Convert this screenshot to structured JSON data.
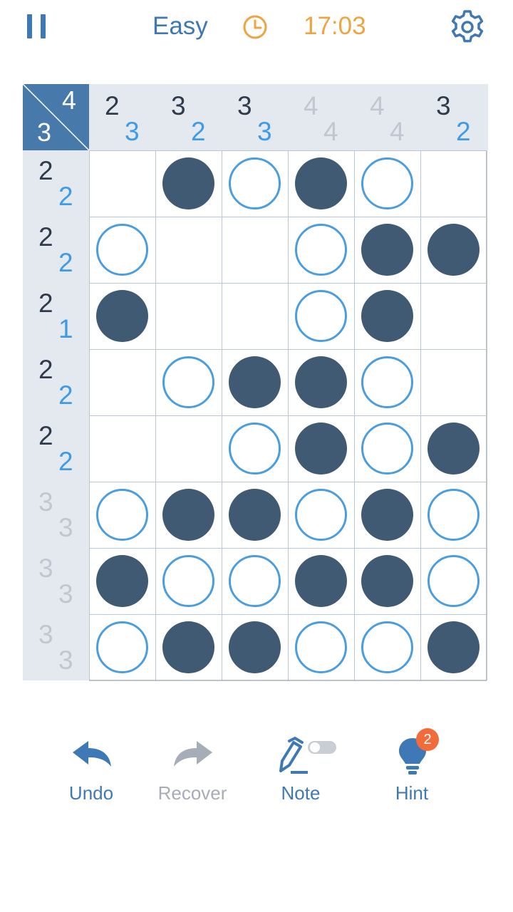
{
  "header": {
    "difficulty": "Easy",
    "timer": "17:03",
    "accent_color": "#3f79b5",
    "timer_color": "#f0a441",
    "icons": [
      "pause-icon",
      "clock-icon",
      "gear-icon"
    ]
  },
  "corner": {
    "top": "4",
    "bottom": "3"
  },
  "columns": [
    {
      "top": "2",
      "bottom": "3",
      "state": "active"
    },
    {
      "top": "3",
      "bottom": "2",
      "state": "active"
    },
    {
      "top": "3",
      "bottom": "3",
      "state": "active"
    },
    {
      "top": "4",
      "bottom": "4",
      "state": "done"
    },
    {
      "top": "4",
      "bottom": "4",
      "state": "done"
    },
    {
      "top": "3",
      "bottom": "2",
      "state": "active"
    }
  ],
  "rows": [
    {
      "top": "2",
      "bottom": "2",
      "state": "active",
      "cells": [
        "",
        "B",
        "W",
        "B",
        "W",
        ""
      ]
    },
    {
      "top": "2",
      "bottom": "2",
      "state": "active",
      "cells": [
        "W",
        "",
        "",
        "W",
        "B",
        "B"
      ]
    },
    {
      "top": "2",
      "bottom": "1",
      "state": "active",
      "cells": [
        "B",
        "",
        "",
        "W",
        "B",
        ""
      ]
    },
    {
      "top": "2",
      "bottom": "2",
      "state": "active",
      "cells": [
        "",
        "W",
        "B",
        "B",
        "W",
        ""
      ]
    },
    {
      "top": "2",
      "bottom": "2",
      "state": "active",
      "cells": [
        "",
        "",
        "W",
        "B",
        "W",
        "B"
      ]
    },
    {
      "top": "3",
      "bottom": "3",
      "state": "done",
      "cells": [
        "W",
        "B",
        "B",
        "W",
        "B",
        "W"
      ]
    },
    {
      "top": "3",
      "bottom": "3",
      "state": "done",
      "cells": [
        "B",
        "W",
        "W",
        "B",
        "B",
        "W"
      ]
    },
    {
      "top": "3",
      "bottom": "3",
      "state": "done",
      "cells": [
        "W",
        "B",
        "B",
        "W",
        "W",
        "B"
      ]
    }
  ],
  "toolbar": {
    "undo": "Undo",
    "recover": "Recover",
    "note": "Note",
    "hint": "Hint",
    "hint_count": "2"
  }
}
